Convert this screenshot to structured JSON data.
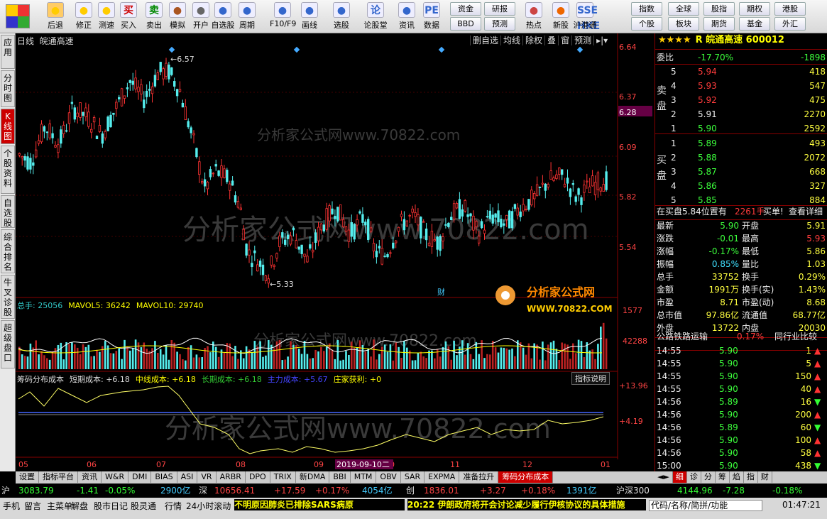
{
  "toolbar": {
    "buttons": [
      {
        "label": "后退",
        "icon": "back-arrow-icon"
      },
      {
        "label": "修正",
        "icon": "sun-icon"
      },
      {
        "label": "测速",
        "icon": "clock-icon"
      },
      {
        "label": "买入",
        "icon": "buy-icon",
        "glyph": "买"
      },
      {
        "label": "卖出",
        "icon": "sell-icon",
        "glyph": "卖"
      },
      {
        "label": "模拟",
        "icon": "hammer-icon"
      },
      {
        "label": "开户",
        "icon": "lock-icon"
      },
      {
        "label": "自选股",
        "icon": "star-icon"
      },
      {
        "label": "周期",
        "icon": "cycle-icon"
      },
      {
        "label": "F10/F9",
        "icon": "f10-icon"
      },
      {
        "label": "画线",
        "icon": "pencil-icon"
      },
      {
        "label": "选股",
        "icon": "screen-icon"
      },
      {
        "label": "论股堂",
        "icon": "forum-icon",
        "glyph": "论"
      },
      {
        "label": "资讯",
        "icon": "news-icon"
      },
      {
        "label": "数据",
        "icon": "pe-icon",
        "glyph": "PE"
      },
      {
        "label": "热点",
        "icon": "fire-icon"
      },
      {
        "label": "新股",
        "icon": "ipo-icon"
      },
      {
        "label": "沪港通",
        "icon": "sse-hkex-icon",
        "glyph": "SSE HKE"
      }
    ],
    "small": [
      "资金",
      "研报",
      "BBD",
      "预测",
      "指数",
      "全球",
      "股指",
      "期权",
      "港股",
      "个股",
      "板块",
      "期货",
      "基金",
      "外汇"
    ]
  },
  "side_tabs": [
    "应用",
    "分时图",
    "K线图",
    "个股资料",
    "自选股",
    "综合排名",
    "牛叉诊股",
    "超级盘口"
  ],
  "chart": {
    "period": "日线",
    "name": "皖通高速",
    "buttons": [
      "删自选",
      "均线",
      "除权",
      "叠",
      "窗",
      "预测"
    ],
    "price_axis": [
      "6.64",
      "6.37",
      "6.28",
      "6.09",
      "5.82",
      "5.54"
    ],
    "high_label": "6.57",
    "low_label": "5.33",
    "vol_axis": [
      "1577",
      "42288"
    ],
    "ind_axis": [
      "13.96",
      "4.19"
    ],
    "months": [
      "05",
      "06",
      "07",
      "08",
      "09",
      "10",
      "11",
      "12",
      "01"
    ],
    "date_badge": "2019-09-10二",
    "watermark": "分析家公式网www.70822.com",
    "logo_text": "分析家公式网",
    "logo_url": "WWW.70822.COM",
    "cai": "财",
    "vol_header": [
      {
        "t": "总手: 25056",
        "c": "#3cc"
      },
      {
        "t": "MAVOL5: 36242",
        "c": "#ff0"
      },
      {
        "t": "MAVOL10: 29740",
        "c": "#ff0"
      }
    ],
    "ind_header": [
      {
        "t": "筹码分布成本",
        "c": "#ddd"
      },
      {
        "t": "短期成本: +6.18",
        "c": "#ddd"
      },
      {
        "t": "中线成本: +6.18",
        "c": "#ff0"
      },
      {
        "t": "长期成本: +6.18",
        "c": "#3c3"
      },
      {
        "t": "主力成本: +5.67",
        "c": "#44f"
      },
      {
        "t": "庄家获利: +0",
        "c": "#ff0"
      }
    ],
    "ind_btn": "指标说明"
  },
  "chart_data": {
    "type": "candlestick",
    "prices_y_range": [
      5.2,
      6.7
    ],
    "note": "daily"
  },
  "stock": {
    "title": "R 皖通高速 600012",
    "stars": "★★★★",
    "weibi": [
      "委比",
      "-17.70%",
      "-1898"
    ],
    "asks": [
      [
        "5",
        "5.94",
        "418"
      ],
      [
        "4",
        "5.93",
        "547"
      ],
      [
        "3",
        "5.92",
        "475"
      ],
      [
        "2",
        "5.91",
        "2270"
      ],
      [
        "1",
        "5.90",
        "2592"
      ]
    ],
    "bids": [
      [
        "1",
        "5.89",
        "493"
      ],
      [
        "2",
        "5.88",
        "2072"
      ],
      [
        "3",
        "5.87",
        "668"
      ],
      [
        "4",
        "5.86",
        "327"
      ],
      [
        "5",
        "5.85",
        "884"
      ]
    ],
    "sell_label": "卖盘",
    "buy_label": "买盘",
    "notice": "在买盘5.84位置有",
    "notice2": "2261手",
    "notice3": "买单!",
    "notice4": "查看详细",
    "stats": [
      [
        "最新",
        "5.90",
        "开盘",
        "5.91"
      ],
      [
        "涨跌",
        "-0.01",
        "最高",
        "5.93"
      ],
      [
        "涨幅",
        "-0.17%",
        "最低",
        "5.86"
      ],
      [
        "振幅",
        "0.85%",
        "量比",
        "1.03"
      ],
      [
        "总手",
        "33752",
        "换手",
        "0.29%"
      ],
      [
        "金额",
        "1991万",
        "换手(实)",
        "1.43%"
      ],
      [
        "市盈",
        "8.71",
        "市盈(动)",
        "8.68"
      ],
      [
        "总市值",
        "97.86亿",
        "流通值",
        "68.77亿"
      ],
      [
        "外盘",
        "13722",
        "内盘",
        "20030"
      ]
    ],
    "industry": [
      "公路铁路运输",
      "0.17%",
      "同行业比较"
    ],
    "ticks": [
      [
        "14:55",
        "5.90",
        "1",
        "up"
      ],
      [
        "14:55",
        "5.90",
        "5",
        "up"
      ],
      [
        "14:55",
        "5.90",
        "150",
        "up"
      ],
      [
        "14:55",
        "5.90",
        "40",
        "up"
      ],
      [
        "14:56",
        "5.89",
        "16",
        "down"
      ],
      [
        "14:56",
        "5.90",
        "200",
        "up"
      ],
      [
        "14:56",
        "5.89",
        "60",
        "down"
      ],
      [
        "14:56",
        "5.90",
        "100",
        "up"
      ],
      [
        "14:56",
        "5.90",
        "58",
        "up"
      ],
      [
        "15:00",
        "5.90",
        "438",
        "down"
      ]
    ]
  },
  "bottom_tabs": [
    "设置",
    "指标平台",
    "资讯",
    "W&R",
    "DMI",
    "BIAS",
    "ASI",
    "VR",
    "ARBR",
    "DPO",
    "TRIX",
    "新DMA",
    "BBI",
    "MTM",
    "OBV",
    "SAR",
    "EXPMA",
    "准备拉升",
    "筹码分布成本"
  ],
  "right_tabs": [
    "细",
    "诊",
    "分",
    "筹",
    "焰",
    "指",
    "财"
  ],
  "index_bar": [
    {
      "t": "沪",
      "c": "#ddd"
    },
    {
      "t": "3083.79",
      "c": "#3f3"
    },
    {
      "t": "-1.41",
      "c": "#3f3"
    },
    {
      "t": "-0.05%",
      "c": "#3f3"
    },
    {
      "t": "2900亿",
      "c": "#4cf"
    },
    {
      "t": "深",
      "c": "#ddd"
    },
    {
      "t": "10656.41",
      "c": "#f44"
    },
    {
      "t": "+17.59",
      "c": "#f44"
    },
    {
      "t": "+0.17%",
      "c": "#f44"
    },
    {
      "t": "4054亿",
      "c": "#4cf"
    },
    {
      "t": "创",
      "c": "#ddd"
    },
    {
      "t": "1836.01",
      "c": "#f44"
    },
    {
      "t": "+3.27",
      "c": "#f44"
    },
    {
      "t": "+0.18%",
      "c": "#f44"
    },
    {
      "t": "1391亿",
      "c": "#4cf"
    },
    {
      "t": "沪深300",
      "c": "#ddd"
    },
    {
      "t": "4144.96",
      "c": "#3f3"
    },
    {
      "t": "-7.28",
      "c": "#3f3"
    },
    {
      "t": "-0.18%",
      "c": "#3f3"
    }
  ],
  "status": {
    "items": [
      "手机",
      "留言",
      "主菜单",
      "解盘",
      "股市日记",
      "股灵通",
      "行情",
      "24小时滚动"
    ],
    "news1": "不明原因肺炎已排除SARS病原",
    "news2": "20:22 伊朗政府将开会讨论减少履行伊核协议的具体措施",
    "search": "代码/名称/简拼/功能",
    "time": "01:47:21"
  }
}
